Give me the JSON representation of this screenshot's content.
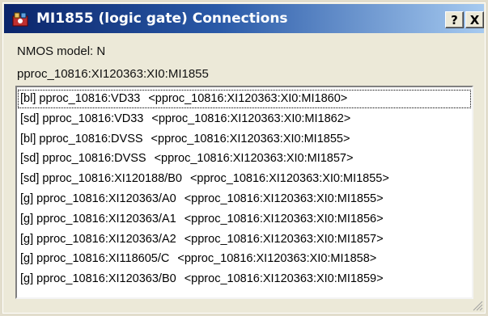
{
  "window": {
    "title": "MI1855 (logic gate) Connections",
    "icon": "app-icon",
    "help_label": "?",
    "close_label": "X"
  },
  "info": {
    "model_label": "NMOS model: N",
    "path_label": "pproc_10816:XI120363:XI0:MI1855"
  },
  "connections": [
    {
      "pin": "[bl]",
      "net": "pproc_10816:VD33",
      "target": "<pproc_10816:XI120363:XI0:MI1860>",
      "selected": true
    },
    {
      "pin": "[sd]",
      "net": "pproc_10816:VD33",
      "target": "<pproc_10816:XI120363:XI0:MI1862>"
    },
    {
      "pin": "[bl]",
      "net": "pproc_10816:DVSS",
      "target": "<pproc_10816:XI120363:XI0:MI1855>"
    },
    {
      "pin": "[sd]",
      "net": "pproc_10816:DVSS",
      "target": "<pproc_10816:XI120363:XI0:MI1857>"
    },
    {
      "pin": "[sd]",
      "net": "pproc_10816:XI120188/B0",
      "target": "<pproc_10816:XI120363:XI0:MI1855>"
    },
    {
      "pin": "[g]",
      "net": "pproc_10816:XI120363/A0",
      "target": "<pproc_10816:XI120363:XI0:MI1855>"
    },
    {
      "pin": "[g]",
      "net": "pproc_10816:XI120363/A1",
      "target": "<pproc_10816:XI120363:XI0:MI1856>"
    },
    {
      "pin": "[g]",
      "net": "pproc_10816:XI120363/A2",
      "target": "<pproc_10816:XI120363:XI0:MI1857>"
    },
    {
      "pin": "[g]",
      "net": "pproc_10816:XI118605/C",
      "target": "<pproc_10816:XI120363:XI0:MI1858>"
    },
    {
      "pin": "[g]",
      "net": "pproc_10816:XI120363/B0",
      "target": "<pproc_10816:XI120363:XI0:MI1859>"
    }
  ]
}
